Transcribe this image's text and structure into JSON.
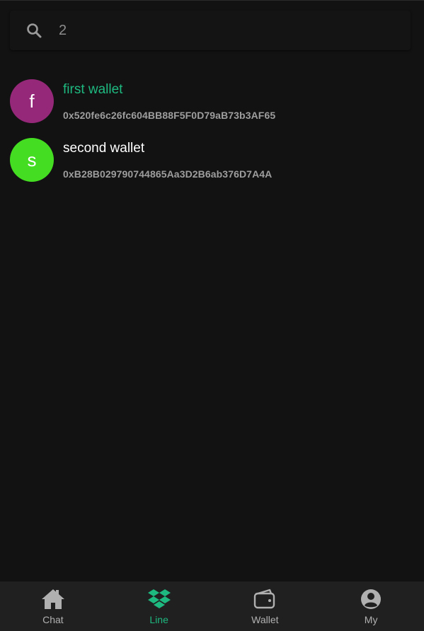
{
  "search": {
    "value": "2",
    "icon": "search-icon"
  },
  "wallets": [
    {
      "initial": "f",
      "name": "first wallet",
      "address": "0x520fe6c26fc604BB88F5F0D79aB73b3AF65",
      "avatar_color": "#96287a",
      "name_color": "#1eb980"
    },
    {
      "initial": "s",
      "name": "second wallet",
      "address": "0xB28B029790744865Aa3D2B6ab376D7A4A",
      "avatar_color": "#44dd22",
      "name_color": "#ffffff"
    }
  ],
  "nav": {
    "items": [
      {
        "label": "Chat",
        "icon": "home-icon"
      },
      {
        "label": "Line",
        "icon": "dropbox-icon",
        "active": true
      },
      {
        "label": "Wallet",
        "icon": "wallet-icon"
      },
      {
        "label": "My",
        "icon": "account-circle-icon"
      }
    ],
    "accent": "#1eb980",
    "inactive_color": "#b0b0b0"
  }
}
